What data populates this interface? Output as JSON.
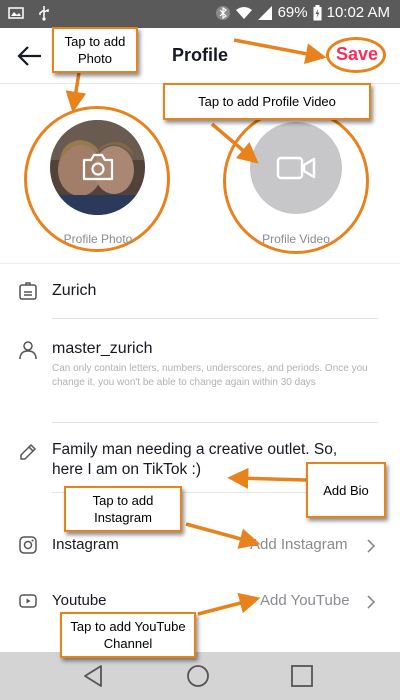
{
  "status_bar": {
    "battery": "69%",
    "time": "10:02 AM"
  },
  "header": {
    "title": "Profile",
    "save_label": "Save"
  },
  "media": {
    "photo_label": "Profile Photo",
    "video_label": "Profile Video"
  },
  "fields": {
    "name": "Zurich",
    "username": "master_zurich",
    "username_helper": "Can only contain letters, numbers, underscores, and periods. Once you change it, you won't be able to change again within 30 days",
    "bio": "Family man needing a creative outlet. So, here I am on TikTok :)"
  },
  "social": {
    "instagram_label": "Instagram",
    "instagram_action": "Add Instagram",
    "youtube_label": "Youtube",
    "youtube_action": "Add YouTube"
  },
  "callouts": {
    "add_photo": "Tap to add Photo",
    "add_video": "Tap to add Profile Video",
    "add_bio": "Add Bio",
    "add_instagram": "Tap to add Instagram",
    "add_youtube": "Tap to add YouTube Channel"
  },
  "colors": {
    "accent": "#fe2c55",
    "annotation": "#e8821d",
    "status_bar": "#5a5a5a",
    "nav_bar": "#d4d4d4"
  },
  "icons": {
    "status_left": [
      "image-icon",
      "usb-icon"
    ],
    "status_right": [
      "bluetooth-icon",
      "wifi-icon",
      "signal-icon",
      "battery-icon"
    ],
    "navigation": [
      "back-triangle-icon",
      "home-circle-icon",
      "recents-square-icon"
    ]
  }
}
